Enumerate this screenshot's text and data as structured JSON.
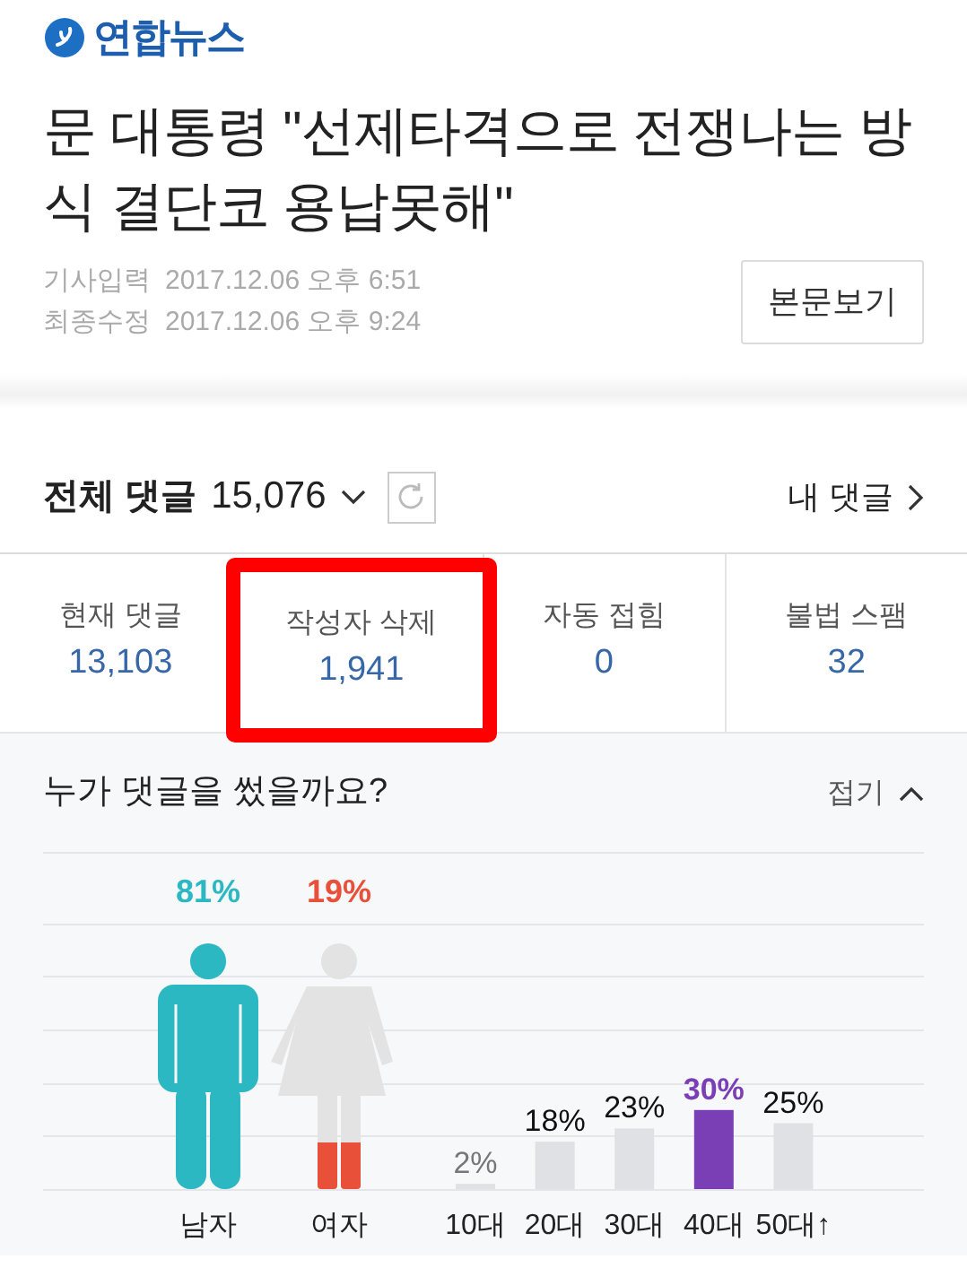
{
  "logo": {
    "text": "연합뉴스"
  },
  "article": {
    "title": "문 대통령 \"선제타격으로 전쟁나는 방식 결단코 용납못해\"",
    "meta": [
      {
        "label": "기사입력",
        "value": "2017.12.06 오후 6:51"
      },
      {
        "label": "최종수정",
        "value": "2017.12.06 오후 9:24"
      }
    ],
    "button": "본문보기"
  },
  "comments": {
    "title": "전체 댓글",
    "count": "15,076",
    "my_comments": "내 댓글",
    "stats": [
      {
        "label": "현재 댓글",
        "value": "13,103",
        "highlighted": false
      },
      {
        "label": "작성자 삭제",
        "value": "1,941",
        "highlighted": true
      },
      {
        "label": "자동 접힘",
        "value": "0",
        "highlighted": false
      },
      {
        "label": "불법 스팸",
        "value": "32",
        "highlighted": false
      }
    ]
  },
  "demographics": {
    "title": "누가 댓글을 썼을까요?",
    "toggle": "접기",
    "gender": [
      {
        "kind": "male",
        "label": "남자",
        "percent": "81%",
        "color": "#2cb8c3"
      },
      {
        "kind": "female",
        "label": "여자",
        "percent": "19%",
        "color": "#e8503a"
      }
    ],
    "age": {
      "chart_data": {
        "type": "bar",
        "categories": [
          "10대",
          "20대",
          "30대",
          "40대",
          "50대↑"
        ],
        "series": [
          {
            "values": [
              2,
              18,
              23,
              30,
              25
            ],
            "value_labels": [
              "2%",
              "18%",
              "23%",
              "30%",
              "25%"
            ]
          }
        ]
      },
      "highlighted": [
        false,
        false,
        false,
        true,
        false
      ]
    }
  }
}
